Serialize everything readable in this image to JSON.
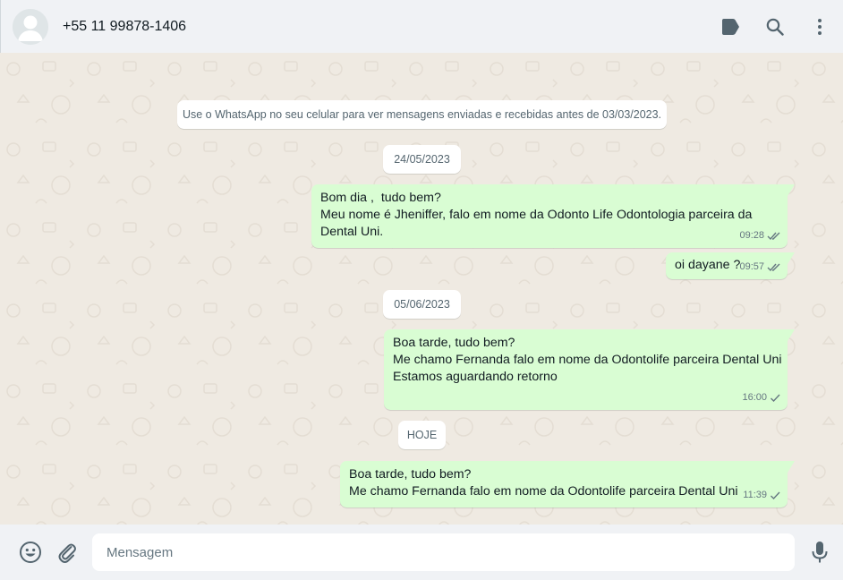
{
  "header": {
    "contact_name": "+55 11 99878-1406",
    "icons": [
      "label-icon",
      "search-icon",
      "menu-icon"
    ]
  },
  "chat": {
    "encryption_notice": "Use o WhatsApp no seu celular para ver mensagens enviadas e recebidas antes de 03/03/2023.",
    "date_1": "24/05/2023",
    "date_2": "05/06/2023",
    "date_3": "HOJE",
    "messages": [
      {
        "lines": [
          "Bom dia ,  tudo bem?",
          "Meu nome é Jheniffer, falo em nome da Odonto Life Odontologia parceira da",
          "Dental Uni."
        ],
        "time": "09:28",
        "status": "read"
      },
      {
        "lines": [
          "oi dayane ?"
        ],
        "time": "09:57",
        "status": "read"
      },
      {
        "lines": [
          "Boa tarde, tudo bem?",
          "Me chamo Fernanda falo em nome da Odontolife parceira Dental Uni",
          "",
          "Estamos aguardando retorno"
        ],
        "time": "16:00",
        "status": "sent"
      },
      {
        "lines": [
          "Boa tarde, tudo bem?",
          "Me chamo Fernanda falo em nome da Odontolife parceira Dental Uni"
        ],
        "time": "11:39",
        "status": "sent"
      }
    ]
  },
  "footer": {
    "placeholder": "Mensagem",
    "value": ""
  },
  "colors": {
    "header_bg": "#f0f2f5",
    "chat_bg": "#efeae2",
    "outgoing_bubble": "#d9fdd3",
    "icon": "#54656f",
    "read_tick": "#667781"
  }
}
